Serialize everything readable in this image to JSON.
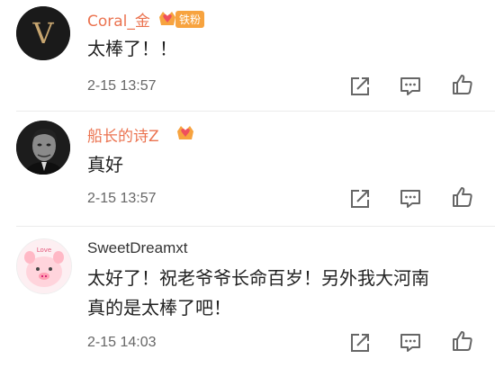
{
  "comments": [
    {
      "username": "Coral_金",
      "badge_label": "铁粉",
      "text_lines": [
        "太棒了！！"
      ],
      "timestamp": "2-15 13:57",
      "avatar_letter": "V"
    },
    {
      "username": "船长的诗Z",
      "text_lines": [
        "真好"
      ],
      "timestamp": "2-15 13:57"
    },
    {
      "username": "SweetDreamxt",
      "text_lines": [
        "太好了！祝老爷爷长命百岁！另外我大河南",
        "真的是太棒了吧！"
      ],
      "timestamp": "2-15 14:03",
      "avatar_tag": "Love"
    }
  ],
  "icons": {
    "share": "share-icon",
    "comment": "comment-icon",
    "like": "like-icon",
    "crown": "crown-badge-icon"
  },
  "colors": {
    "username_highlight": "#eb7350",
    "badge_bg": "#f7a33f",
    "heart": "#ef4f5d"
  }
}
